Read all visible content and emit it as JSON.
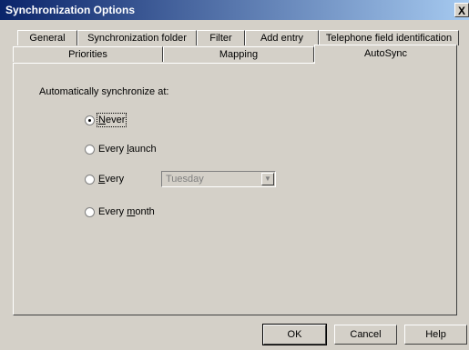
{
  "window": {
    "title": "Synchronization Options",
    "close_label": "X"
  },
  "tabs_row1": [
    {
      "label": "General"
    },
    {
      "label": "Synchronization folder"
    },
    {
      "label": "Filter"
    },
    {
      "label": "Add entry"
    },
    {
      "label": "Telephone field identification"
    }
  ],
  "tabs_row2": [
    {
      "label": "Priorities"
    },
    {
      "label": "Mapping"
    },
    {
      "label": "AutoSync"
    }
  ],
  "active_tab": "AutoSync",
  "autosync": {
    "heading": "Automatically synchronize at:",
    "options": [
      {
        "label": "Never",
        "checked": true
      },
      {
        "label": "Every launch",
        "checked": false
      },
      {
        "label": "Every",
        "checked": false
      },
      {
        "label": "Every month",
        "checked": false
      }
    ],
    "weekday_select": {
      "value": "Tuesday",
      "enabled": false
    }
  },
  "buttons": {
    "ok": "OK",
    "cancel": "Cancel",
    "help": "Help"
  }
}
